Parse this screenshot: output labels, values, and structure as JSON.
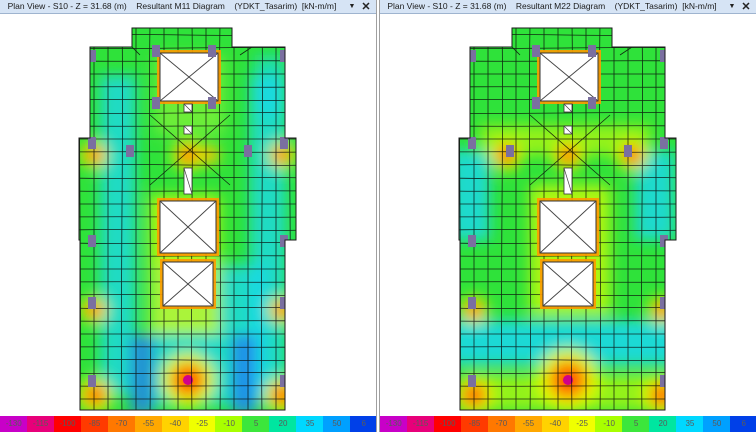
{
  "windows": [
    {
      "title_view": "Plan View - S10 - Z = 31.68 (m)",
      "title_diagram": "Resultant M11 Diagram",
      "title_combo": "(YDKT_Tasarim)",
      "title_units": "[kN-m/m]",
      "dropdown_icon": "chevron-down-icon",
      "close_icon": "close-icon"
    },
    {
      "title_view": "Plan View - S10 - Z = 31.68 (m)",
      "title_diagram": "Resultant M22 Diagram",
      "title_combo": "(YDKT_Tasarim)",
      "title_units": "[kN-m/m]",
      "dropdown_icon": "chevron-down-icon",
      "close_icon": "close-icon"
    }
  ],
  "legend": [
    {
      "label": "-130",
      "color": "#c800c8"
    },
    {
      "label": "-115",
      "color": "#e8007a"
    },
    {
      "label": "-100",
      "color": "#ff0000"
    },
    {
      "label": "-85",
      "color": "#ff3a00"
    },
    {
      "label": "-70",
      "color": "#ff7800"
    },
    {
      "label": "-55",
      "color": "#ffa800"
    },
    {
      "label": "-40",
      "color": "#ffd200"
    },
    {
      "label": "-25",
      "color": "#f0ff00"
    },
    {
      "label": "-10",
      "color": "#a8ff00"
    },
    {
      "label": "5",
      "color": "#3ce63c"
    },
    {
      "label": "20",
      "color": "#00e6a0"
    },
    {
      "label": "35",
      "color": "#00d8ff"
    },
    {
      "label": "50",
      "color": "#00a0ff"
    },
    {
      "label": "6",
      "color": "#0040e8"
    }
  ],
  "palette": {
    "green": "#2fe23a",
    "light_green": "#7cf03a",
    "yellow": "#e6ff00",
    "orange": "#ff9a00",
    "red": "#ff2a00",
    "magenta": "#d0008a",
    "cyan": "#18d8f0",
    "blue": "#1f7cf0",
    "column": "#7a6fa0",
    "mesh": "#0a0a0a"
  }
}
